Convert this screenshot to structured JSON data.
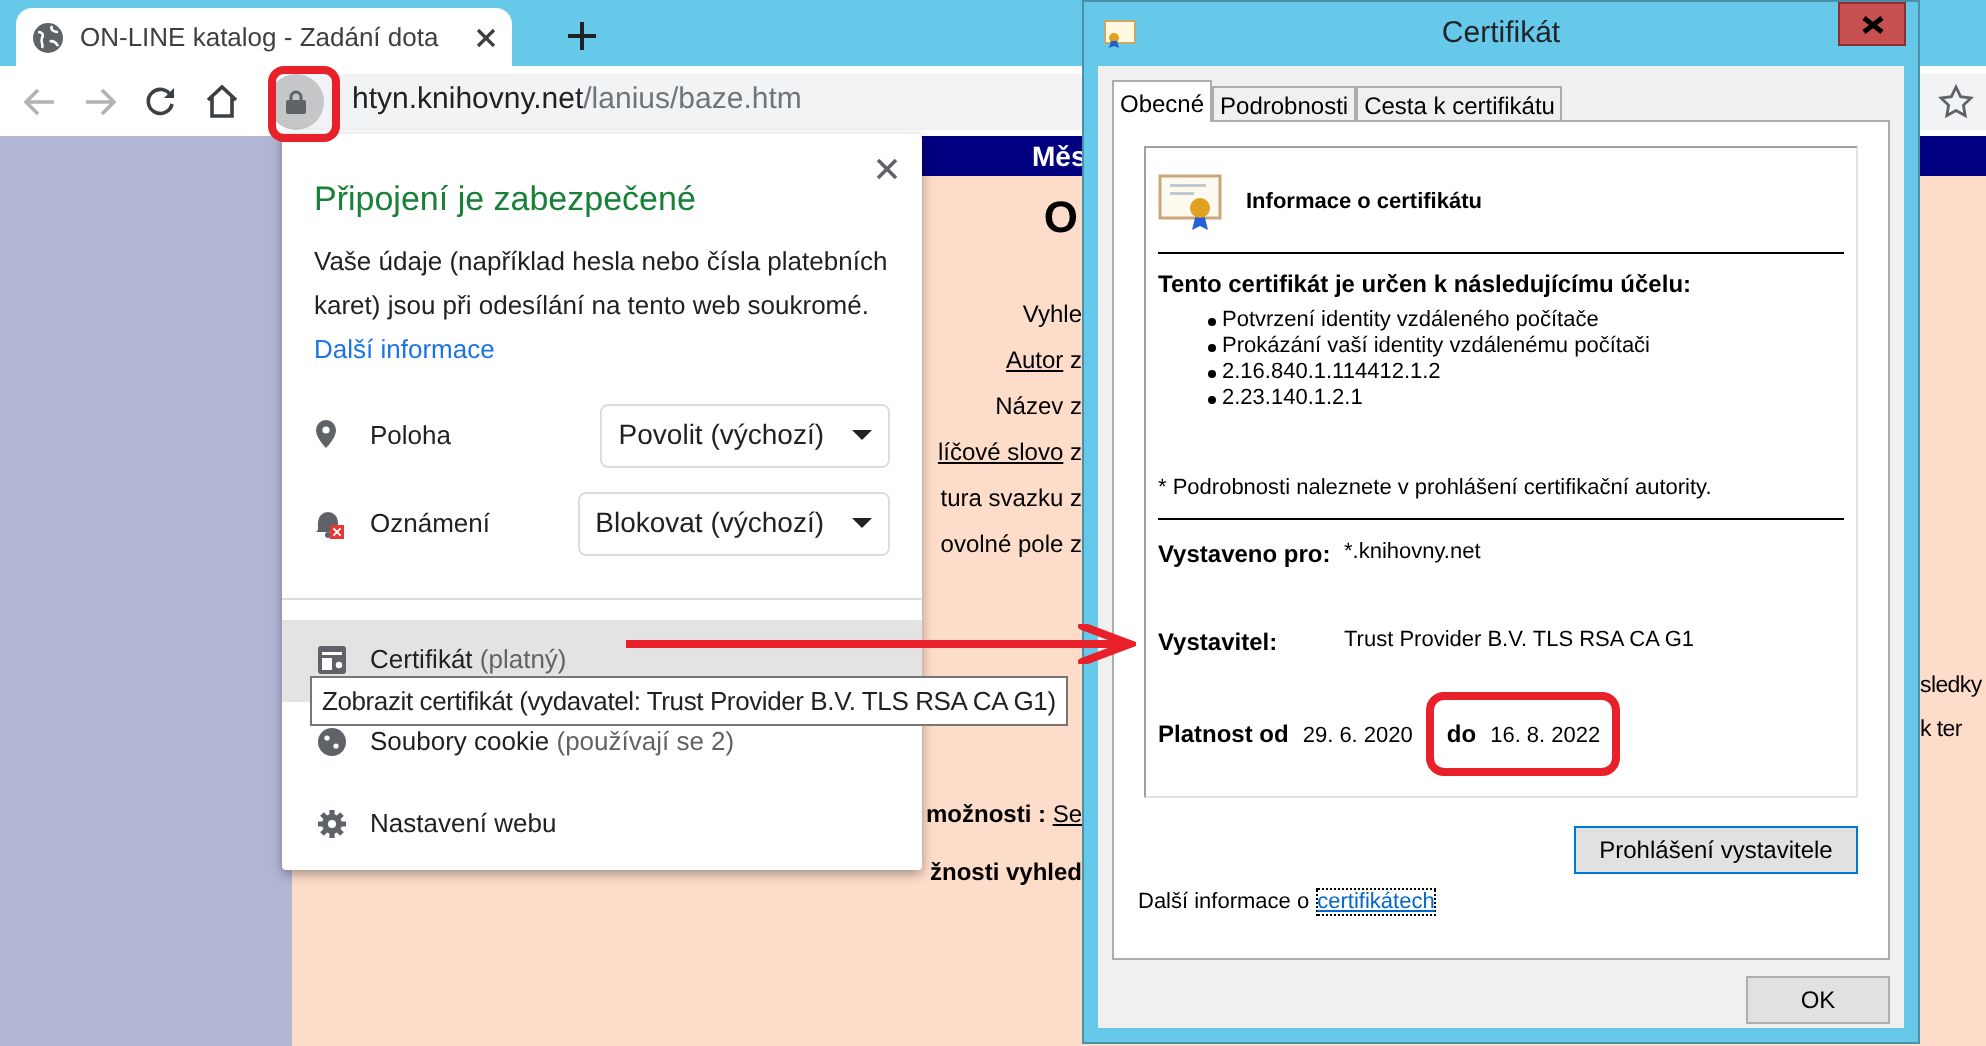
{
  "browser": {
    "tab": {
      "title": "ON-LINE katalog - Zadání dota"
    },
    "address": {
      "host": "htyn.knihovny.net",
      "path": "/lanius/baze.htm"
    }
  },
  "page": {
    "banner": "Měs",
    "heading": "O",
    "form_lines": [
      {
        "parts": [
          {
            "text": "Vyhle",
            "link": false
          }
        ]
      },
      {
        "parts": [
          {
            "text": "Autor",
            "link": true
          },
          {
            "text": " z",
            "link": false
          }
        ]
      },
      {
        "parts": [
          {
            "text": "Název z",
            "link": false
          }
        ]
      },
      {
        "parts": [
          {
            "text": "líčové slovo",
            "link": true
          },
          {
            "text": " z",
            "link": false
          }
        ]
      },
      {
        "parts": [
          {
            "text": "tura svazku z",
            "link": false
          }
        ]
      },
      {
        "parts": [
          {
            "text": "ovolné pole z",
            "link": false
          }
        ]
      }
    ],
    "options": {
      "label": "možnosti :",
      "link": "Se"
    },
    "search_options": "žnosti vyhled",
    "side_texts": [
      "sledky",
      "k ter"
    ]
  },
  "site_popup": {
    "title": "Připojení je zabezpečené",
    "description": "Vaše údaje (například hesla nebo čísla platebních karet) jsou při odesílání na tento web soukromé.",
    "more_link": "Další informace",
    "permissions": [
      {
        "kind": "location",
        "label": "Poloha",
        "value": "Povolit (výchozí)"
      },
      {
        "kind": "notifications",
        "label": "Oznámení",
        "value": "Blokovat (výchozí)"
      }
    ],
    "items": [
      {
        "kind": "certificate",
        "label": "Certifikát",
        "detail": "(platný)",
        "highlighted": true
      },
      {
        "kind": "cookies",
        "label": "Soubory cookie",
        "detail": "(používají se 2)",
        "highlighted": false
      },
      {
        "kind": "settings",
        "label": "Nastavení webu",
        "highlighted": false
      }
    ],
    "tooltip": "Zobrazit certifikát (vydavatel: Trust Provider B.V. TLS RSA CA G1)"
  },
  "dialog": {
    "title": "Certifikát",
    "tabs": [
      {
        "label": "Obecné",
        "selected": true
      },
      {
        "label": "Podrobnosti",
        "selected": false
      },
      {
        "label": "Cesta k certifikátu",
        "selected": false
      }
    ],
    "heading": "Informace o certifikátu",
    "purpose_title": "Tento certifikát je určen k následujícímu účelu:",
    "purposes": [
      "Potvrzení identity vzdáleného počítače",
      "Prokázání vaší identity vzdálenému počítači",
      "2.16.840.1.114412.1.2",
      "2.23.140.1.2.1"
    ],
    "note": "* Podrobnosti naleznete v prohlášení certifikační autority.",
    "issued_to": {
      "label": "Vystaveno pro:",
      "value": "*.knihovny.net"
    },
    "issuer": {
      "label": "Vystavitel:",
      "value": "Trust Provider B.V. TLS RSA CA G1"
    },
    "validity": {
      "label": "Platnost od",
      "from": "29. 6. 2020",
      "to_label": "do",
      "to": "16. 8. 2022"
    },
    "statement_button": "Prohlášení vystavitele",
    "footer_text": "Další informace o",
    "footer_link": "certifikátech",
    "ok_button": "OK"
  }
}
